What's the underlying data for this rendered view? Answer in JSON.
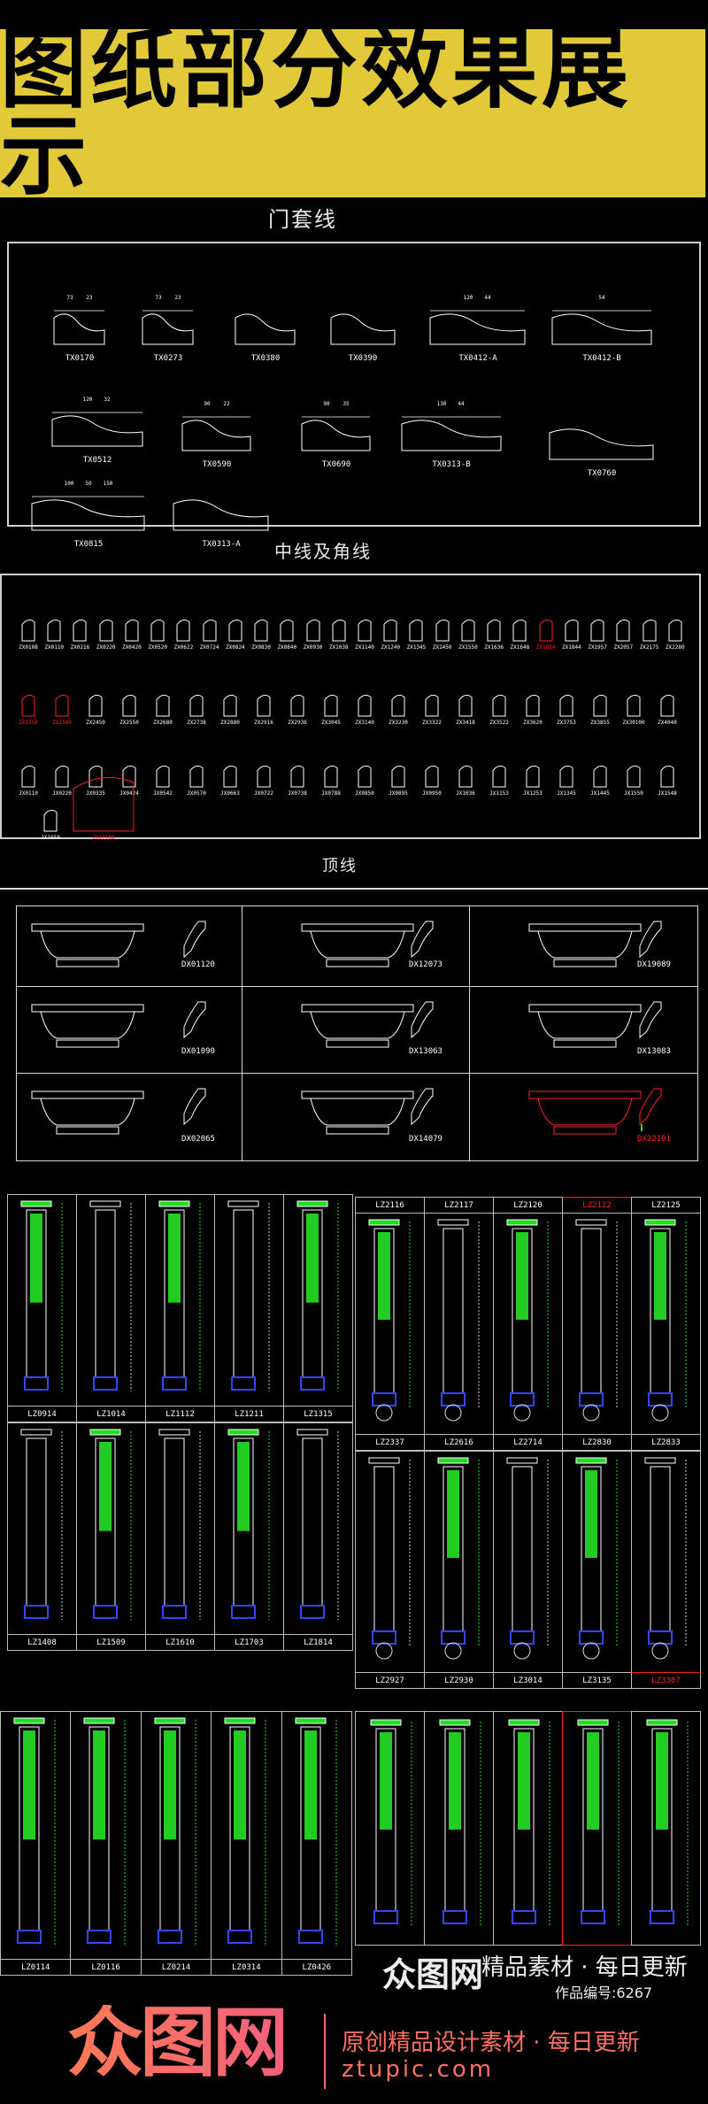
{
  "banner": {
    "title": "图纸部分效果展示"
  },
  "colors": {
    "banner": "#e2c93a",
    "cad_line": "#ffffff",
    "cad_green": "#22dd22",
    "cad_blue": "#2233ff",
    "cad_red": "#ff2020",
    "brand": "#ff7062"
  },
  "door_casing": {
    "title": "门套线",
    "items": [
      {
        "label": "TX0170",
        "dims": [
          "73",
          "23"
        ]
      },
      {
        "label": "TX0273",
        "dims": [
          "73",
          "23"
        ]
      },
      {
        "label": "TX0380",
        "dims": []
      },
      {
        "label": "TX0390",
        "dims": []
      },
      {
        "label": "TX0412-A",
        "dims": [
          "120",
          "44"
        ]
      },
      {
        "label": "TX0412-B",
        "dims": [
          "54"
        ]
      },
      {
        "label": "TX0512",
        "dims": [
          "120",
          "32"
        ]
      },
      {
        "label": "TX0590",
        "dims": [
          "90",
          "22"
        ]
      },
      {
        "label": "TX0690",
        "dims": [
          "90",
          "35"
        ]
      },
      {
        "label": "TX0313-B",
        "dims": [
          "130",
          "44"
        ]
      },
      {
        "label": "TX0760",
        "dims": []
      },
      {
        "label": "TX0815",
        "dims": [
          "100",
          "50",
          "150"
        ]
      },
      {
        "label": "TX0313-A",
        "dims": []
      }
    ]
  },
  "middle_corner": {
    "title": "中线及角线",
    "rows": [
      [
        {
          "l": "ZX0108"
        },
        {
          "l": "ZX0110"
        },
        {
          "l": "ZX0216"
        },
        {
          "l": "ZX0220"
        },
        {
          "l": "ZX0420"
        },
        {
          "l": "ZX0520"
        },
        {
          "l": "ZX0622"
        },
        {
          "l": "ZX0724"
        },
        {
          "l": "ZX0824"
        },
        {
          "l": "ZX0830"
        },
        {
          "l": "ZX0840"
        },
        {
          "l": "ZX0930"
        },
        {
          "l": "ZX1038"
        },
        {
          "l": "ZX1140"
        },
        {
          "l": "ZX1240"
        },
        {
          "l": "ZX1345"
        },
        {
          "l": "ZX1450"
        },
        {
          "l": "ZX1550"
        },
        {
          "l": "ZX1636"
        },
        {
          "l": "ZX1648"
        },
        {
          "l": "ZX1854",
          "red": true
        },
        {
          "l": "ZX1844"
        },
        {
          "l": "ZX1957"
        },
        {
          "l": "ZX2057"
        },
        {
          "l": "ZX2175"
        },
        {
          "l": "ZX2280"
        }
      ],
      [
        {
          "l": "ZX1350",
          "red": true
        },
        {
          "l": "ZX2380",
          "red": true
        },
        {
          "l": "ZX2450"
        },
        {
          "l": "ZX2550"
        },
        {
          "l": "ZX2680"
        },
        {
          "l": "ZX2738"
        },
        {
          "l": "ZX2880"
        },
        {
          "l": "ZX2916"
        },
        {
          "l": "ZX2936"
        },
        {
          "l": "ZX3045"
        },
        {
          "l": "ZX3140"
        },
        {
          "l": "ZX3230"
        },
        {
          "l": "ZX3322"
        },
        {
          "l": "ZX3418"
        },
        {
          "l": "ZX3522"
        },
        {
          "l": "ZX3620"
        },
        {
          "l": "ZX3753"
        },
        {
          "l": "ZX3855"
        },
        {
          "l": "ZX30100"
        },
        {
          "l": "ZX4040"
        }
      ],
      [
        {
          "l": "JX0110"
        },
        {
          "l": "JX0220"
        },
        {
          "l": "JX0335"
        },
        {
          "l": "JX0424"
        },
        {
          "l": "JX0542"
        },
        {
          "l": "JX0570"
        },
        {
          "l": "JX0663"
        },
        {
          "l": "JX0722"
        },
        {
          "l": "JX0738"
        },
        {
          "l": "JX0788"
        },
        {
          "l": "JX0850"
        },
        {
          "l": "JX0895"
        },
        {
          "l": "JX0950"
        },
        {
          "l": "JX1036"
        },
        {
          "l": "JX1153"
        },
        {
          "l": "JX1253"
        },
        {
          "l": "JX1345"
        },
        {
          "l": "JX1445"
        },
        {
          "l": "JX1550"
        },
        {
          "l": "JX1548"
        }
      ],
      [
        {
          "l": "JX1658"
        },
        {
          "l": "JX17108",
          "red": true
        }
      ]
    ]
  },
  "top_line": {
    "title": "顶线",
    "cells": [
      {
        "label": "DX01120"
      },
      {
        "label": "DX12073"
      },
      {
        "label": "DX19089"
      },
      {
        "label": "DX01090"
      },
      {
        "label": "DX13063"
      },
      {
        "label": "DX13083"
      },
      {
        "label": "DX02065"
      },
      {
        "label": "DX14079"
      },
      {
        "label": "DX22101",
        "red": true
      }
    ]
  },
  "columns": {
    "block_a": {
      "rows": [
        [
          "LZ0914",
          "LZ1014",
          "LZ1112",
          "LZ1211",
          "LZ1315"
        ],
        [
          "LZ1408",
          "LZ1509",
          "LZ1610",
          "LZ1703",
          "LZ1814"
        ]
      ]
    },
    "block_b": {
      "header": [
        "LZ2116",
        "LZ2117",
        "LZ2120",
        "LZ2122",
        "LZ2125"
      ],
      "header_red": [
        false,
        false,
        false,
        true,
        false
      ],
      "rows": [
        [
          "LZ2337",
          "LZ2616",
          "LZ2714",
          "LZ2830",
          "LZ2833"
        ],
        [
          "LZ2927",
          "LZ2930",
          "LZ3014",
          "LZ3135",
          "LZ3307"
        ]
      ],
      "last_red": true
    },
    "block_c": {
      "rows": [
        [
          "LZ0114",
          "LZ0116",
          "LZ0214",
          "LZ0314",
          "LZ0426"
        ]
      ]
    }
  },
  "watermark": {
    "logo": "众图网",
    "slogan": "精品素材 · 每日更新",
    "work_id": "作品编号:6267"
  },
  "brand": {
    "logo": "众图网",
    "slogan": "原创精品设计素材 · 每日更新",
    "url": "ztupic.com"
  }
}
